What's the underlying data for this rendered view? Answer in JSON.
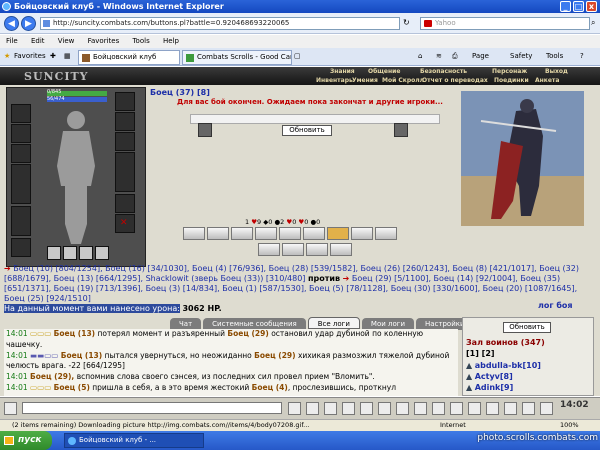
{
  "window": {
    "title": "Бойцовский клуб - Windows Internet Explorer",
    "minimize": "_",
    "maximize": "□",
    "close": "x"
  },
  "address": {
    "url": "http://suncity.combats.com/buttons.pl?battle=0.920468693220065",
    "search_placeholder": "Yahoo"
  },
  "menu": [
    "File",
    "Edit",
    "View",
    "Favorites",
    "Tools",
    "Help"
  ],
  "favorites_label": "Favorites",
  "tabs": [
    {
      "label": "Бойцовский клуб"
    },
    {
      "label": "Combats Scrolls - Good Car - ..."
    }
  ],
  "toolbar": {
    "page": "Page",
    "safety": "Safety",
    "tools": "Tools"
  },
  "game": {
    "logo": "SUNCITY",
    "top_links": [
      "Знания",
      "Общение",
      "Безопасность",
      "Персонаж",
      "Выход"
    ],
    "sub_links": [
      "Инвентарь",
      "Умения",
      "Мой Скролл",
      "Отчет о переводах",
      "Поединки",
      "Анкета"
    ],
    "hp_text": "0/845",
    "mp_text": "56/474",
    "fighter_header": "Боец (37) [8]",
    "battle_over_msg": "Для вас бой окончен. Ожидаем пока закончат и другие игроки...",
    "refresh_button": "Обновить",
    "counters": [
      "1",
      "9",
      "0",
      "2",
      "0",
      "0",
      "0"
    ],
    "fighters_line_1": "Боец (10) [804/1254], Боец (16) [34/1030], Боец (4) [76/936], Боец (28) [539/1582], Боец (26) [260/1243], Боец (8) [421/1017], Боец (32) [688/1679], Боец (13) [664/1295], Shacklowit (зверь Боец (33)) [310/480]",
    "vs": "против",
    "fighters_line_2": "Боец (29) [5/1100], Боец (14) [92/1004], Боец (35) [651/1371], Боец (19) [713/1396], Боец (3) [14/834], Боец (1) [587/1530], Боец (5) [78/1128], Боец (30) [330/1600], Боец (20) [1087/1645], Боец (25) [924/1510]",
    "battle_log_link": "лог боя",
    "hp_info_sel": "На данный момент вами нанесено урона:",
    "hp_info_val": "3062 HP.",
    "chat_tabs": [
      "Чат",
      "Системные сообщения",
      "Все логи",
      "Мои логи",
      "Настройки"
    ],
    "chat_lines": [
      {
        "time": "14:01",
        "name": "Боец (13)",
        "text": "потерял момент и разъяренный",
        "name2": "Боец (29)",
        "text2": "остановил удар дубиной по коленную чашечку."
      },
      {
        "time": "14:01",
        "name": "Боец (13)",
        "text": "пытался увернуться, но неожиданно",
        "name2": "Боец (29)",
        "text2": "хихикая размозжил тяжелой дубиной челюсть врага. -22 [664/1295]"
      },
      {
        "time": "14:01",
        "name": "Боец (29),",
        "text": "вспомнив слова своего сэнсея, из последних сил провел прием \"Вломить\".",
        "name2": "",
        "text2": ""
      },
      {
        "time": "14:01",
        "name": "Боец (5)",
        "text": "пришла в себя, а в это время жестокий",
        "name2": "Боец (4)",
        "text2": ", прослезившись, проткнул"
      }
    ],
    "right_refresh": "Обновить",
    "warriors_title": "Зал воинов (347)",
    "warriors_pages": "[1] [2]",
    "warriors": [
      "abdulla-bk[10]",
      "Actyv[8]",
      "Adink[9]"
    ],
    "clock": "14:02"
  },
  "status": {
    "text": "(2 items remaining) Downloading picture http://img.combats.com//items/4/body07208.gif...",
    "zone": "Internet",
    "zoom": "100%"
  },
  "taskbar": {
    "start": "пуск",
    "item": "Бойцовский клуб - ...",
    "watermark": "photo.scrolls.combats.com"
  }
}
